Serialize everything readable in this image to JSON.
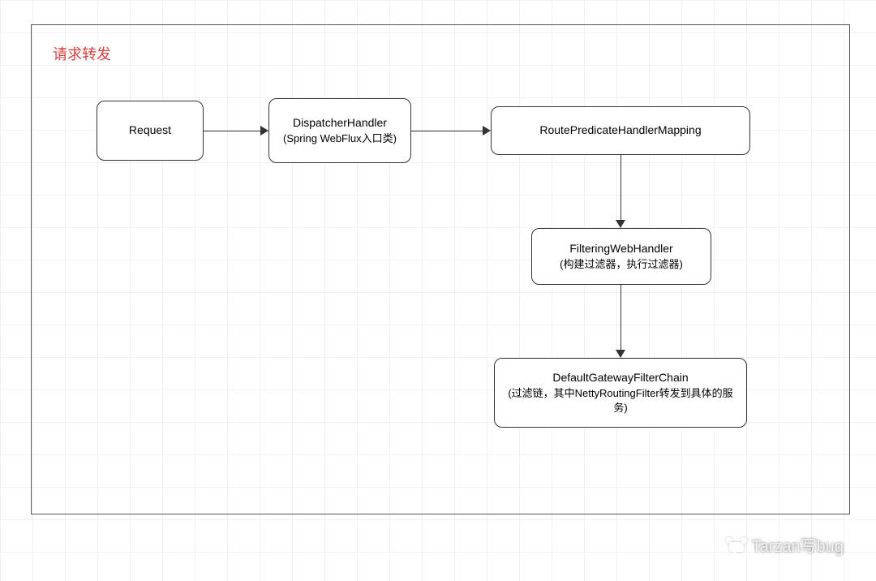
{
  "diagram": {
    "title": "请求转发",
    "nodes": {
      "request": {
        "line1": "Request"
      },
      "dispatcher": {
        "line1": "DispatcherHandler",
        "line2": "(Spring WebFlux入口类)"
      },
      "route": {
        "line1": "RoutePredicateHandlerMapping"
      },
      "filtering": {
        "line1": "FilteringWebHandler",
        "line2": "(构建过滤器，执行过滤器)"
      },
      "chain": {
        "line1": "DefaultGatewayFilterChain",
        "line2": "(过滤链，其中NettyRoutingFilter转发到具体的服务)"
      }
    }
  },
  "watermark": {
    "text": "Tarzan写bug"
  }
}
